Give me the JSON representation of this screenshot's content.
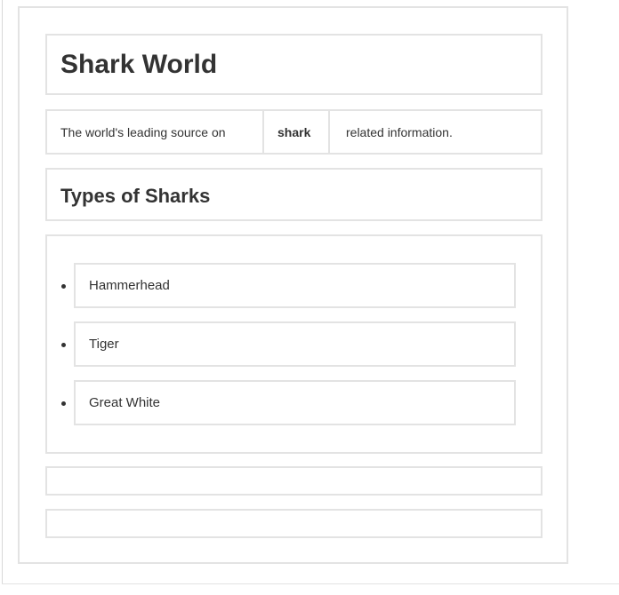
{
  "header": {
    "title": "Shark World"
  },
  "tagline": {
    "part1": "The world's leading source on",
    "part2": "shark",
    "part3": "related information."
  },
  "section": {
    "heading": "Types of Sharks"
  },
  "sharks": [
    {
      "label": "Hammerhead"
    },
    {
      "label": "Tiger"
    },
    {
      "label": "Great White"
    }
  ]
}
